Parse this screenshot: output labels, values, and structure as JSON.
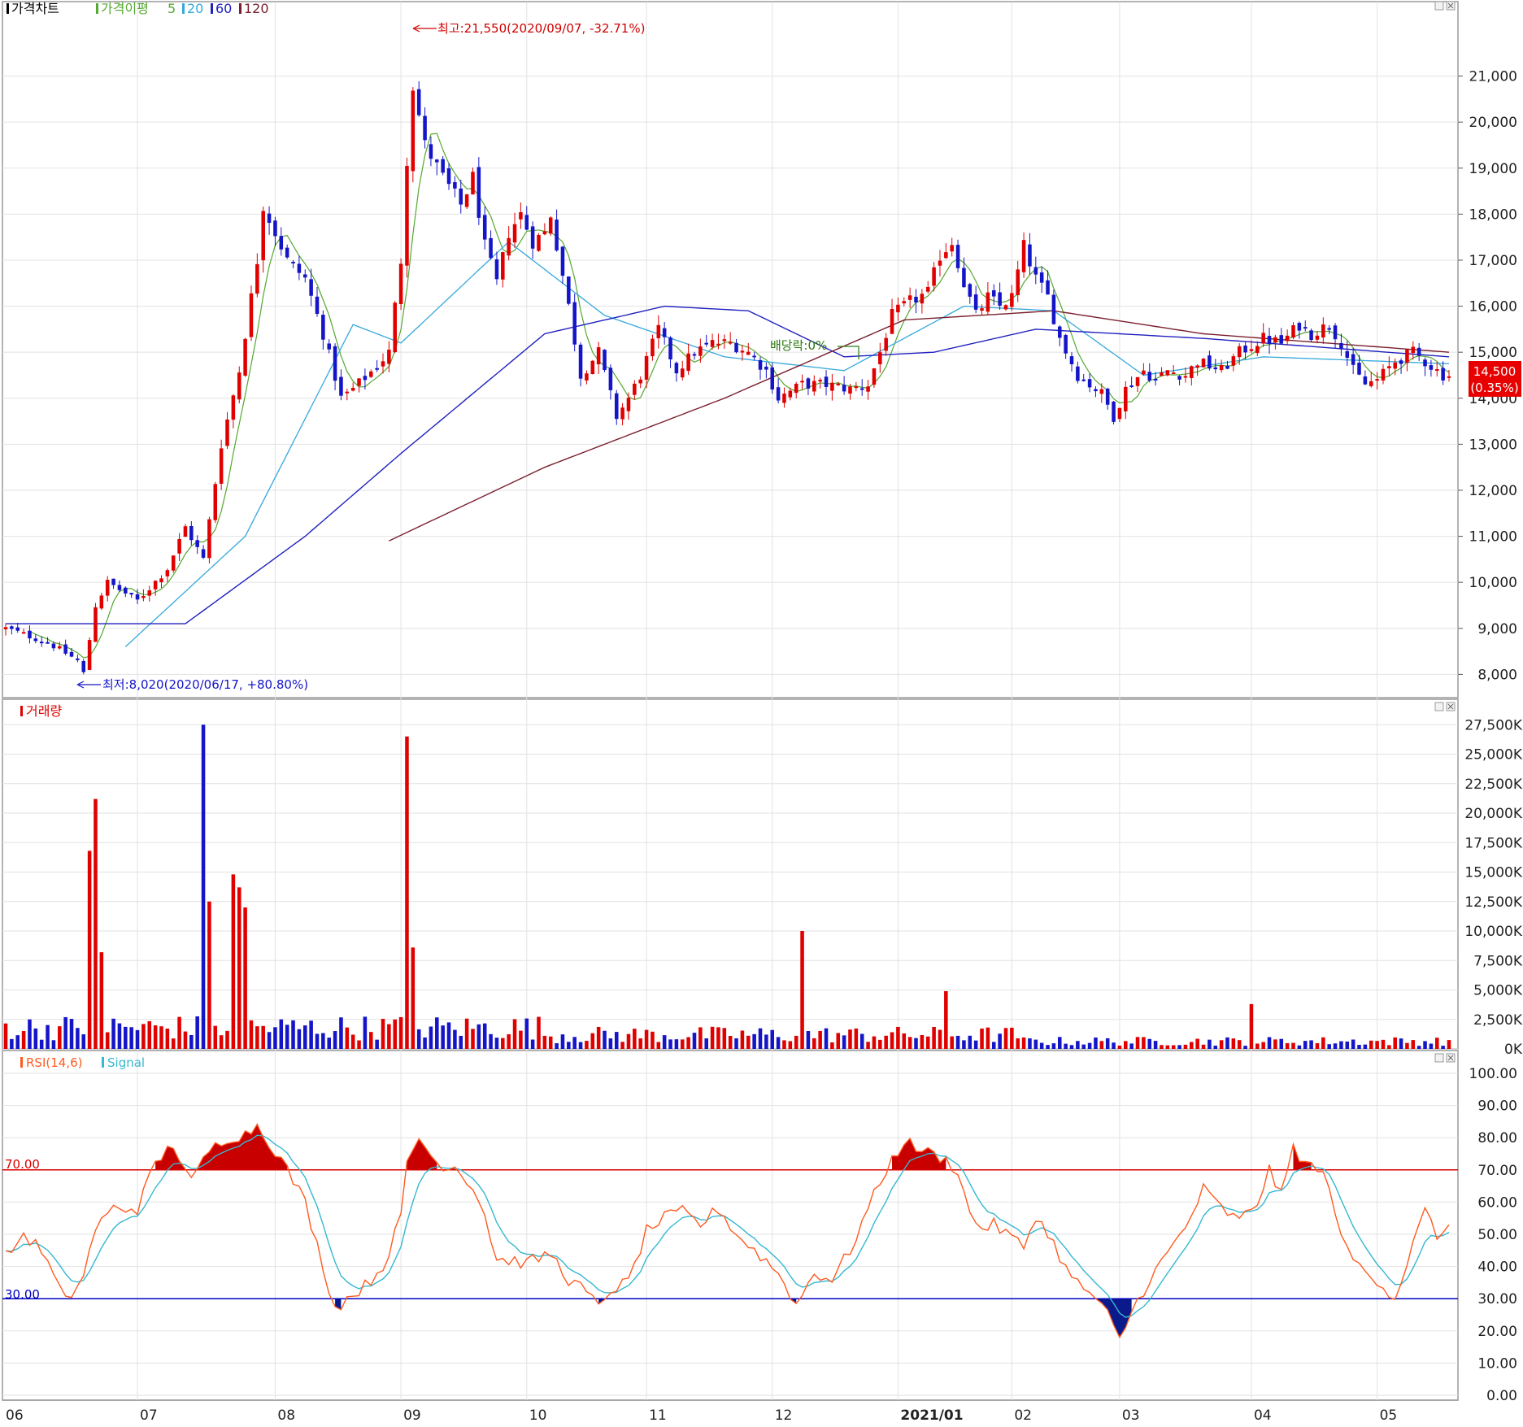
{
  "colors": {
    "up": "#e00000",
    "down": "#1515c8",
    "ma5": "#55a830",
    "ma20": "#35a8dc",
    "ma60": "#2020c0",
    "ma120": "#7a1f2e",
    "rsi": "#ff5a20",
    "signal": "#35b8d0",
    "line70": "#d80000",
    "line30": "#0000c0",
    "grid": "#e2e2e2",
    "frame": "#9a9a9a"
  },
  "price_panel": {
    "title": "가격차트",
    "ma_label": "가격이평",
    "ma_periods": [
      "5",
      "20",
      "60",
      "120"
    ],
    "yticks": [
      "8,000",
      "9,000",
      "10,000",
      "11,000",
      "12,000",
      "13,000",
      "14,000",
      "15,000",
      "16,000",
      "17,000",
      "18,000",
      "19,000",
      "20,000",
      "21,000"
    ],
    "high_annotation": "최고:21,550(2020/09/07, -32.71%)",
    "low_annotation": "최저:8,020(2020/06/17, +80.80%)",
    "dividend_annotation": "배당락:0%",
    "last_price": "14,500",
    "last_change": "(0.35%)"
  },
  "volume_panel": {
    "title": "거래량",
    "yticks": [
      "0K",
      "2,500K",
      "5,000K",
      "7,500K",
      "10,000K",
      "12,500K",
      "15,000K",
      "17,500K",
      "20,000K",
      "22,500K",
      "25,000K",
      "27,500K"
    ]
  },
  "rsi_panel": {
    "title": "RSI(14,6)",
    "signal_label": "Signal",
    "level70": "70.00",
    "level30": "30.00",
    "yticks": [
      "0.00",
      "10.00",
      "20.00",
      "30.00",
      "40.00",
      "50.00",
      "60.00",
      "70.00",
      "80.00",
      "90.00",
      "100.00"
    ]
  },
  "x_labels": [
    "06",
    "07",
    "08",
    "09",
    "10",
    "11",
    "12",
    "2021/01",
    "02",
    "03",
    "04",
    "05"
  ],
  "chart_data": {
    "type": "candlestick",
    "period": "daily, 2020/06 - 2021/05",
    "price_ylim": [
      7600,
      22300
    ],
    "month_starts": [
      0,
      22,
      45,
      66,
      87,
      107,
      128,
      149,
      168,
      186,
      208,
      229
    ],
    "anchors": [
      [
        0,
        9000
      ],
      [
        7,
        8700
      ],
      [
        12,
        8300
      ],
      [
        13,
        8020
      ],
      [
        15,
        9500
      ],
      [
        17,
        10000
      ],
      [
        22,
        9600
      ],
      [
        27,
        10300
      ],
      [
        30,
        11200
      ],
      [
        33,
        10500
      ],
      [
        36,
        13000
      ],
      [
        39,
        14600
      ],
      [
        42,
        17000
      ],
      [
        43,
        18200
      ],
      [
        47,
        17000
      ],
      [
        50,
        16600
      ],
      [
        53,
        15400
      ],
      [
        56,
        14000
      ],
      [
        58,
        14200
      ],
      [
        62,
        14700
      ],
      [
        64,
        15000
      ],
      [
        66,
        17000
      ],
      [
        67,
        19200
      ],
      [
        68,
        20800
      ],
      [
        70,
        19500
      ],
      [
        73,
        18800
      ],
      [
        76,
        18200
      ],
      [
        78,
        18800
      ],
      [
        80,
        17300
      ],
      [
        82,
        16500
      ],
      [
        84,
        17600
      ],
      [
        86,
        18000
      ],
      [
        88,
        17400
      ],
      [
        90,
        17600
      ],
      [
        91,
        18000
      ],
      [
        94,
        16000
      ],
      [
        96,
        14500
      ],
      [
        99,
        15000
      ],
      [
        102,
        13600
      ],
      [
        104,
        14000
      ],
      [
        106,
        14500
      ],
      [
        109,
        15500
      ],
      [
        112,
        14600
      ],
      [
        115,
        15000
      ],
      [
        118,
        15200
      ],
      [
        121,
        15200
      ],
      [
        124,
        15000
      ],
      [
        127,
        14600
      ],
      [
        129,
        14000
      ],
      [
        133,
        14300
      ],
      [
        137,
        14300
      ],
      [
        141,
        14200
      ],
      [
        144,
        14300
      ],
      [
        146,
        15000
      ],
      [
        148,
        15800
      ],
      [
        151,
        16100
      ],
      [
        154,
        16300
      ],
      [
        156,
        17100
      ],
      [
        158,
        17400
      ],
      [
        160,
        16500
      ],
      [
        162,
        15800
      ],
      [
        164,
        16200
      ],
      [
        166,
        16000
      ],
      [
        168,
        16200
      ],
      [
        170,
        17300
      ],
      [
        172,
        16600
      ],
      [
        174,
        16200
      ],
      [
        176,
        15300
      ],
      [
        179,
        14500
      ],
      [
        181,
        14300
      ],
      [
        183,
        14100
      ],
      [
        185,
        13600
      ],
      [
        187,
        14200
      ],
      [
        190,
        14600
      ],
      [
        192,
        14400
      ],
      [
        194,
        14600
      ],
      [
        197,
        14500
      ],
      [
        199,
        14800
      ],
      [
        203,
        14600
      ],
      [
        206,
        15000
      ],
      [
        210,
        15300
      ],
      [
        213,
        15200
      ],
      [
        216,
        15600
      ],
      [
        218,
        15400
      ],
      [
        221,
        15600
      ],
      [
        223,
        15200
      ],
      [
        225,
        14600
      ],
      [
        227,
        14300
      ],
      [
        229,
        14400
      ],
      [
        232,
        14800
      ],
      [
        235,
        15000
      ],
      [
        237,
        14800
      ],
      [
        240,
        14500
      ],
      [
        241,
        14500
      ]
    ],
    "ma_values_sampled": {
      "ma20": [
        [
          20,
          8600
        ],
        [
          40,
          11000
        ],
        [
          58,
          15600
        ],
        [
          66,
          15200
        ],
        [
          84,
          17400
        ],
        [
          100,
          15800
        ],
        [
          120,
          14900
        ],
        [
          140,
          14600
        ],
        [
          160,
          16000
        ],
        [
          175,
          15900
        ],
        [
          190,
          14500
        ],
        [
          210,
          14900
        ],
        [
          241,
          14750
        ]
      ],
      "ma60": [
        [
          0,
          9100
        ],
        [
          30,
          9100
        ],
        [
          50,
          11000
        ],
        [
          66,
          12800
        ],
        [
          90,
          15400
        ],
        [
          110,
          16000
        ],
        [
          124,
          15900
        ],
        [
          140,
          14900
        ],
        [
          155,
          15000
        ],
        [
          172,
          15500
        ],
        [
          200,
          15300
        ],
        [
          241,
          14900
        ]
      ],
      "ma120": [
        [
          64,
          10900
        ],
        [
          90,
          12500
        ],
        [
          120,
          14000
        ],
        [
          150,
          15700
        ],
        [
          175,
          15900
        ],
        [
          200,
          15400
        ],
        [
          241,
          15000
        ]
      ]
    },
    "volume_ylim_k": [
      0,
      28000
    ],
    "volume_spikes_k": [
      [
        14,
        16800
      ],
      [
        15,
        21200
      ],
      [
        16,
        8200
      ],
      [
        33,
        27500
      ],
      [
        34,
        12500
      ],
      [
        38,
        14800
      ],
      [
        39,
        13700
      ],
      [
        40,
        12000
      ],
      [
        67,
        26500
      ],
      [
        68,
        8600
      ],
      [
        133,
        10000
      ],
      [
        157,
        4900
      ],
      [
        208,
        3800
      ]
    ],
    "rsi_ylim": [
      0,
      100
    ],
    "rsi_levels": [
      70,
      30
    ],
    "rsi_anchors": [
      [
        0,
        43
      ],
      [
        3,
        50
      ],
      [
        6,
        45
      ],
      [
        10,
        29
      ],
      [
        13,
        37
      ],
      [
        15,
        52
      ],
      [
        18,
        58
      ],
      [
        22,
        58
      ],
      [
        25,
        72
      ],
      [
        28,
        78
      ],
      [
        31,
        66
      ],
      [
        34,
        76
      ],
      [
        37,
        80
      ],
      [
        40,
        81
      ],
      [
        42,
        84
      ],
      [
        45,
        76
      ],
      [
        47,
        70
      ],
      [
        50,
        60
      ],
      [
        53,
        40
      ],
      [
        55,
        27
      ],
      [
        57,
        30
      ],
      [
        60,
        34
      ],
      [
        63,
        40
      ],
      [
        66,
        55
      ],
      [
        67,
        72
      ],
      [
        69,
        80
      ],
      [
        72,
        72
      ],
      [
        75,
        71
      ],
      [
        78,
        65
      ],
      [
        80,
        56
      ],
      [
        82,
        42
      ],
      [
        84,
        42
      ],
      [
        87,
        41
      ],
      [
        91,
        44
      ],
      [
        94,
        36
      ],
      [
        97,
        32
      ],
      [
        99,
        27
      ],
      [
        101,
        33
      ],
      [
        104,
        35
      ],
      [
        107,
        51
      ],
      [
        110,
        55
      ],
      [
        113,
        57
      ],
      [
        116,
        53
      ],
      [
        119,
        58
      ],
      [
        122,
        50
      ],
      [
        125,
        45
      ],
      [
        128,
        40
      ],
      [
        130,
        35
      ],
      [
        132,
        28
      ],
      [
        135,
        38
      ],
      [
        138,
        36
      ],
      [
        141,
        45
      ],
      [
        144,
        58
      ],
      [
        147,
        70
      ],
      [
        150,
        79
      ],
      [
        153,
        76
      ],
      [
        156,
        74
      ],
      [
        159,
        70
      ],
      [
        161,
        56
      ],
      [
        163,
        52
      ],
      [
        165,
        53
      ],
      [
        168,
        49
      ],
      [
        170,
        46
      ],
      [
        172,
        56
      ],
      [
        175,
        47
      ],
      [
        178,
        36
      ],
      [
        181,
        32
      ],
      [
        184,
        25
      ],
      [
        186,
        17
      ],
      [
        188,
        26
      ],
      [
        191,
        36
      ],
      [
        194,
        44
      ],
      [
        197,
        52
      ],
      [
        200,
        64
      ],
      [
        203,
        58
      ],
      [
        206,
        54
      ],
      [
        209,
        60
      ],
      [
        211,
        70
      ],
      [
        213,
        62
      ],
      [
        215,
        77
      ],
      [
        217,
        72
      ],
      [
        219,
        70
      ],
      [
        221,
        66
      ],
      [
        223,
        48
      ],
      [
        226,
        40
      ],
      [
        229,
        36
      ],
      [
        232,
        30
      ],
      [
        235,
        47
      ],
      [
        237,
        57
      ],
      [
        239,
        50
      ],
      [
        241,
        51
      ]
    ]
  }
}
